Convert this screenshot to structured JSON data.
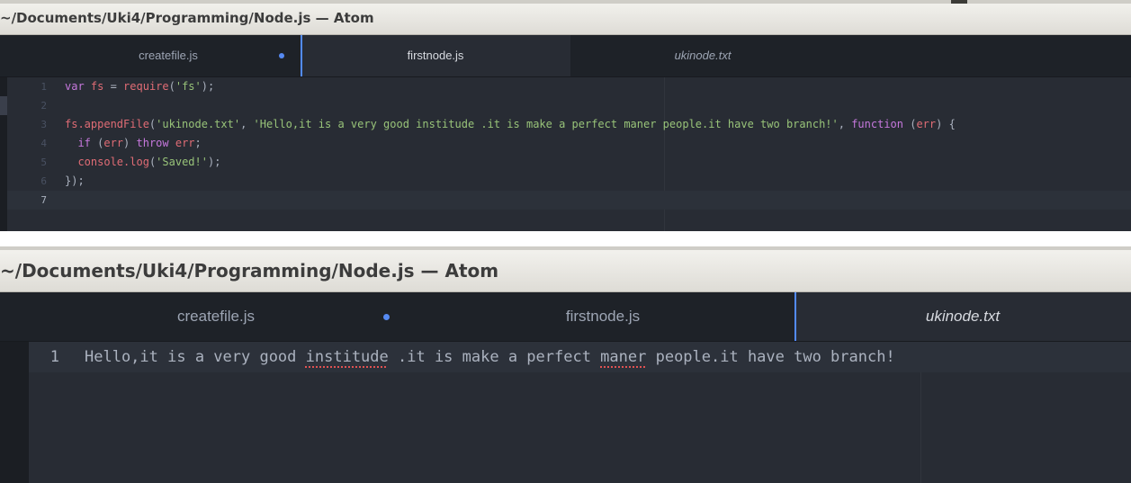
{
  "window_title": "~/Documents/Uki4/Programming/Node.js — Atom",
  "tabs": [
    {
      "label": "createfile.js",
      "modified": true
    },
    {
      "label": "firstnode.js",
      "modified": false
    },
    {
      "label": "ukinode.txt",
      "modified": false
    }
  ],
  "top_view": {
    "active_tab": "firstnode.js",
    "cursor_line": 7,
    "line_numbers": [
      "1",
      "2",
      "3",
      "4",
      "5",
      "6",
      "7"
    ],
    "code": {
      "l1_var": "var",
      "l1_fs": " fs ",
      "l1_eq": "= ",
      "l1_req": "require",
      "l1_p1": "(",
      "l1_str": "'fs'",
      "l1_p2": ");",
      "l3_fs": "fs.appendFile",
      "l3_p1": "(",
      "l3_s1": "'ukinode.txt'",
      "l3_c1": ", ",
      "l3_s2": "'Hello,it is a very good institude .it is make a perfect maner people.it have two branch!'",
      "l3_c2": ", ",
      "l3_fn": "function",
      "l3_p2": " (",
      "l3_err": "err",
      "l3_p3": ") {",
      "l4_ind": "  ",
      "l4_if": "if",
      "l4_p1": " (",
      "l4_err": "err",
      "l4_p2": ") ",
      "l4_throw": "throw",
      "l4_err2": " err",
      "l4_semi": ";",
      "l5_ind": "  ",
      "l5_console": "console.log",
      "l5_p1": "(",
      "l5_str": "'Saved!'",
      "l5_p2": ");",
      "l6_close": "});"
    }
  },
  "bottom_view": {
    "active_tab": "ukinode.txt",
    "line_numbers": [
      "1"
    ],
    "text_parts": [
      "Hello,it is a very good ",
      "institude",
      " .it is make a perfect ",
      "maner",
      " people.it have two branch!"
    ],
    "misspelled": [
      "institude",
      "maner"
    ]
  },
  "colors": {
    "editor_bg": "#282c34",
    "tab_bar_bg": "#1e2228",
    "keyword": "#c678dd",
    "string": "#98c379",
    "identifier": "#e06c75",
    "text": "#abb2bf",
    "modified_dot": "#568af2",
    "active_tab_indicator": "#528bff",
    "spellcheck_underline": "#e05252"
  }
}
